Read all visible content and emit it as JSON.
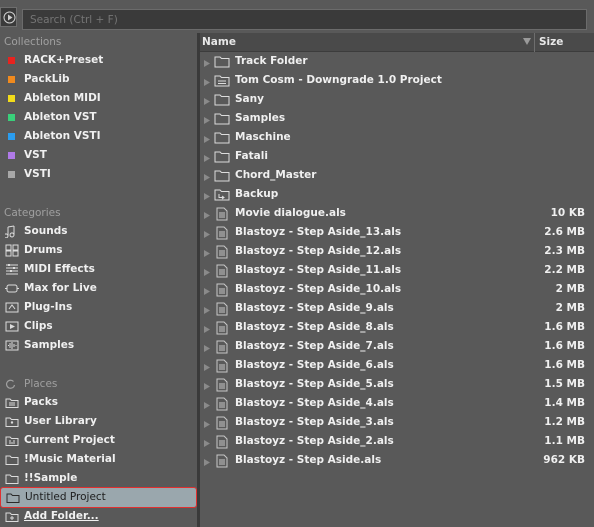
{
  "search": {
    "placeholder": "Search (Ctrl + F)"
  },
  "colors": {
    "background": "#595959",
    "selection": "#9aa7ad",
    "selection_outline": "#e03030"
  },
  "collections": {
    "title": "Collections",
    "items": [
      {
        "label": "RACK+Preset",
        "color": "#e8231f"
      },
      {
        "label": "PackLib",
        "color": "#f08a1e"
      },
      {
        "label": "Ableton MIDI",
        "color": "#f2dc1a"
      },
      {
        "label": "Ableton VST",
        "color": "#39d07a"
      },
      {
        "label": "Ableton VSTI",
        "color": "#2a9df0"
      },
      {
        "label": "VST",
        "color": "#b07ae8"
      },
      {
        "label": "VSTI",
        "color": "#a8a8a8"
      }
    ]
  },
  "categories": {
    "title": "Categories",
    "items": [
      {
        "label": "Sounds",
        "icon": "sounds-icon"
      },
      {
        "label": "Drums",
        "icon": "drums-icon"
      },
      {
        "label": "MIDI Effects",
        "icon": "midi-effects-icon"
      },
      {
        "label": "Max for Live",
        "icon": "max-for-live-icon"
      },
      {
        "label": "Plug-Ins",
        "icon": "plugins-icon"
      },
      {
        "label": "Clips",
        "icon": "clips-icon"
      },
      {
        "label": "Samples",
        "icon": "samples-icon"
      }
    ]
  },
  "places": {
    "title": "Places",
    "items": [
      {
        "label": "Packs",
        "icon": "packs-icon"
      },
      {
        "label": "User Library",
        "icon": "user-library-icon"
      },
      {
        "label": "Current Project",
        "icon": "current-project-icon"
      },
      {
        "label": "!Music Material",
        "icon": "folder-icon"
      },
      {
        "label": "!!Sample",
        "icon": "folder-icon"
      },
      {
        "label": "Untitled Project",
        "icon": "folder-icon",
        "selected": true
      }
    ],
    "add_folder": "Add Folder..."
  },
  "columns": {
    "name": "Name",
    "size": "Size"
  },
  "files": [
    {
      "name": "Track Folder",
      "size": "",
      "type": "folder"
    },
    {
      "name": "Tom Cosm - Downgrade 1.0 Project",
      "size": "",
      "type": "project"
    },
    {
      "name": "Sany",
      "size": "",
      "type": "folder"
    },
    {
      "name": "Samples",
      "size": "",
      "type": "folder"
    },
    {
      "name": "Maschine",
      "size": "",
      "type": "folder"
    },
    {
      "name": "Fatali",
      "size": "",
      "type": "folder"
    },
    {
      "name": "Chord_Master",
      "size": "",
      "type": "folder"
    },
    {
      "name": "Backup",
      "size": "",
      "type": "backup"
    },
    {
      "name": "Movie dialogue.als",
      "size": "10 KB",
      "type": "file"
    },
    {
      "name": "Blastoyz - Step Aside_13.als",
      "size": "2.6 MB",
      "type": "file"
    },
    {
      "name": "Blastoyz - Step Aside_12.als",
      "size": "2.3 MB",
      "type": "file"
    },
    {
      "name": "Blastoyz - Step Aside_11.als",
      "size": "2.2 MB",
      "type": "file"
    },
    {
      "name": "Blastoyz - Step Aside_10.als",
      "size": "2 MB",
      "type": "file"
    },
    {
      "name": "Blastoyz - Step Aside_9.als",
      "size": "2 MB",
      "type": "file"
    },
    {
      "name": "Blastoyz - Step Aside_8.als",
      "size": "1.6 MB",
      "type": "file"
    },
    {
      "name": "Blastoyz - Step Aside_7.als",
      "size": "1.6 MB",
      "type": "file"
    },
    {
      "name": "Blastoyz - Step Aside_6.als",
      "size": "1.6 MB",
      "type": "file"
    },
    {
      "name": "Blastoyz - Step Aside_5.als",
      "size": "1.5 MB",
      "type": "file"
    },
    {
      "name": "Blastoyz - Step Aside_4.als",
      "size": "1.4 MB",
      "type": "file"
    },
    {
      "name": "Blastoyz - Step Aside_3.als",
      "size": "1.2 MB",
      "type": "file"
    },
    {
      "name": "Blastoyz - Step Aside_2.als",
      "size": "1.1 MB",
      "type": "file"
    },
    {
      "name": "Blastoyz - Step Aside.als",
      "size": "962 KB",
      "type": "file"
    }
  ]
}
